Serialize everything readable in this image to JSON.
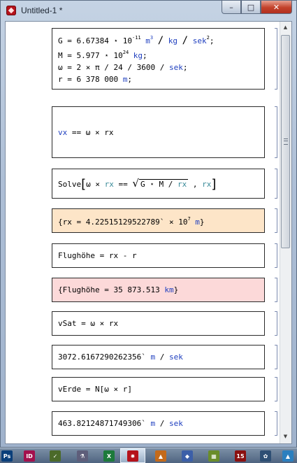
{
  "window": {
    "title": "Untitled-1 *",
    "min": "–",
    "max": "□",
    "close": "✕"
  },
  "cells": {
    "c1": {
      "l1": {
        "a": "G = 6.67384",
        "b": "10",
        "c": "-11",
        "d": "m",
        "e": "3",
        "f": "/",
        "g": "kg",
        "h": "/",
        "i": "sek",
        "j": "2",
        "k": ";"
      },
      "l2": {
        "a": "M = 5.977",
        "b": "10",
        "c": "24",
        "d": "kg",
        "e": ";"
      },
      "l3": {
        "a": "ω = 2 × π / 24 / 3600 / ",
        "b": "sek",
        "c": ";"
      },
      "l4": {
        "a": "r = 6 378 000 ",
        "b": "m",
        "c": ";"
      }
    },
    "c2": {
      "a": "vx",
      "b": " == ω × rx"
    },
    "c3": {
      "a": "Solve",
      "b": "ω × ",
      "c": "rx",
      "d": " == ",
      "e": "G ⋆ M / ",
      "f": "rx",
      "g": " , ",
      "h": "rx"
    },
    "c4": {
      "a": "{rx = 4.22515129522789`",
      "b": "10",
      "c": "7",
      "d": "m",
      "e": "}"
    },
    "c5": {
      "a": "Flughöhe = rx - r"
    },
    "c6": {
      "a": "{Flughöhe = 35 873.513 ",
      "b": "km",
      "c": "}"
    },
    "c7": {
      "a": "vSat = ω × rx"
    },
    "c8": {
      "a": "3072.6167290262356` ",
      "b": "m",
      "c": " / ",
      "d": "sek"
    },
    "c9": {
      "a": "vErde = N[ω × r]"
    },
    "c10": {
      "a": "463.82124871749306` ",
      "b": "m",
      "c": " / ",
      "d": "sek"
    }
  },
  "taskbar": {
    "icons": [
      {
        "label": "Ps",
        "color": "#0a3f7a"
      },
      {
        "label": "ID",
        "color": "#a3104d"
      },
      {
        "label": "✓",
        "color": "#4b6a2a"
      },
      {
        "label": "⚗",
        "color": "#5e5e7a"
      },
      {
        "label": "X",
        "color": "#1d7a3b"
      },
      {
        "label": "✹",
        "color": "#b5121b"
      },
      {
        "label": "▲",
        "color": "#c46a1a"
      },
      {
        "label": "◆",
        "color": "#3c5fa8"
      },
      {
        "label": "▦",
        "color": "#6a8d2a"
      },
      {
        "label": "15",
        "color": "#8a1010"
      },
      {
        "label": "✿",
        "color": "#2e4f74"
      },
      {
        "label": "▲",
        "color": "#2b7fbf"
      }
    ]
  }
}
